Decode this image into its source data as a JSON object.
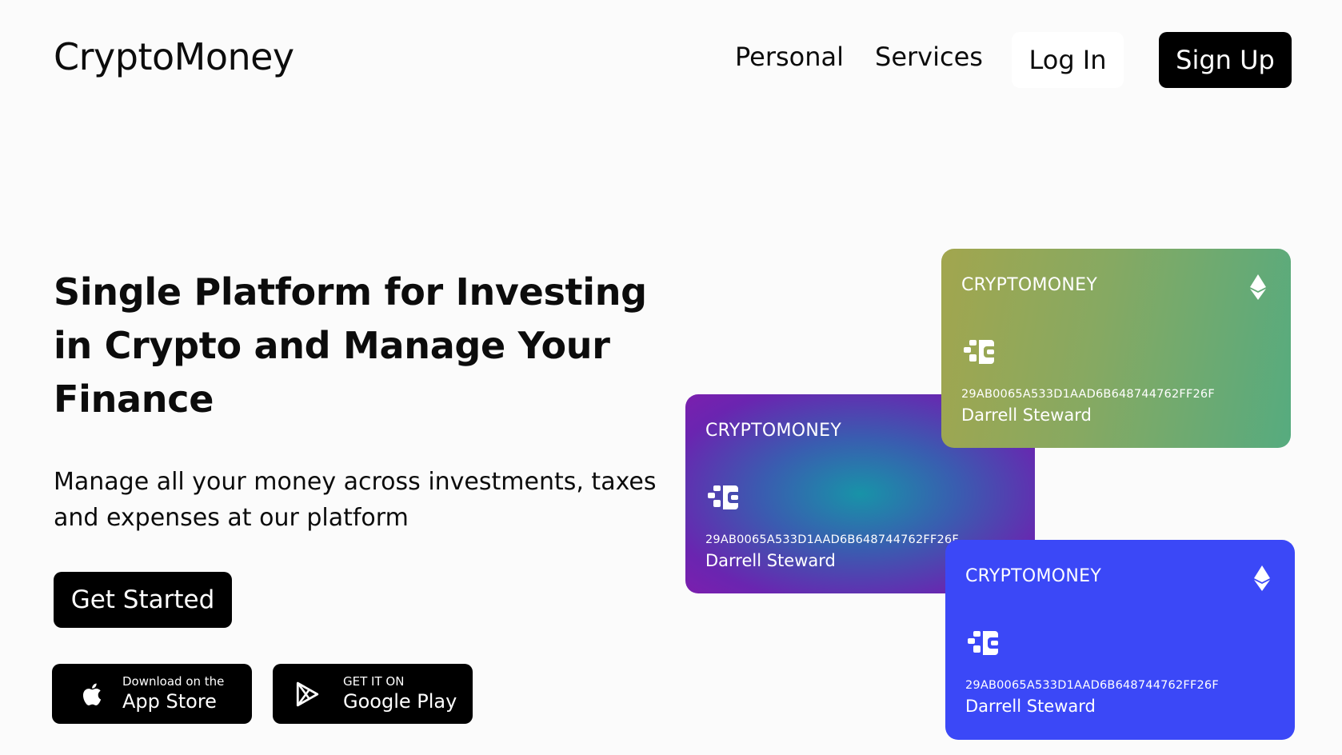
{
  "header": {
    "logo": "CryptoMoney",
    "nav": [
      {
        "label": "Personal"
      },
      {
        "label": "Services"
      }
    ],
    "login_label": "Log In",
    "signup_label": "Sign Up"
  },
  "hero": {
    "title": "Single Platform for Investing in Crypto and Manage Your Finance",
    "subtitle": "Manage all your money across investments, taxes and expenses at our platform",
    "cta_label": "Get Started"
  },
  "stores": {
    "app_store": {
      "small": "Download on the",
      "big": "App Store",
      "icon": "apple-icon"
    },
    "google_play": {
      "small": "GET IT ON",
      "big": "Google Play",
      "icon": "play-icon"
    }
  },
  "cards": [
    {
      "brand": "CRYPTOMONEY",
      "number": "29AB0065A533D1AAD6B648744762FF26F",
      "holder": "Darrell Steward",
      "color": "#6a25b0",
      "icon": "chip-icon"
    },
    {
      "brand": "CRYPTOMONEY",
      "number": "29AB0065A533D1AAD6B648744762FF26F",
      "holder": "Darrell Steward",
      "color": "#86a962",
      "icon": "ethereum-icon"
    },
    {
      "brand": "CRYPTOMONEY",
      "number": "29AB0065A533D1AAD6B648744762FF26F",
      "holder": "Darrell Steward",
      "color": "#3b48f7",
      "icon": "ethereum-icon"
    }
  ]
}
